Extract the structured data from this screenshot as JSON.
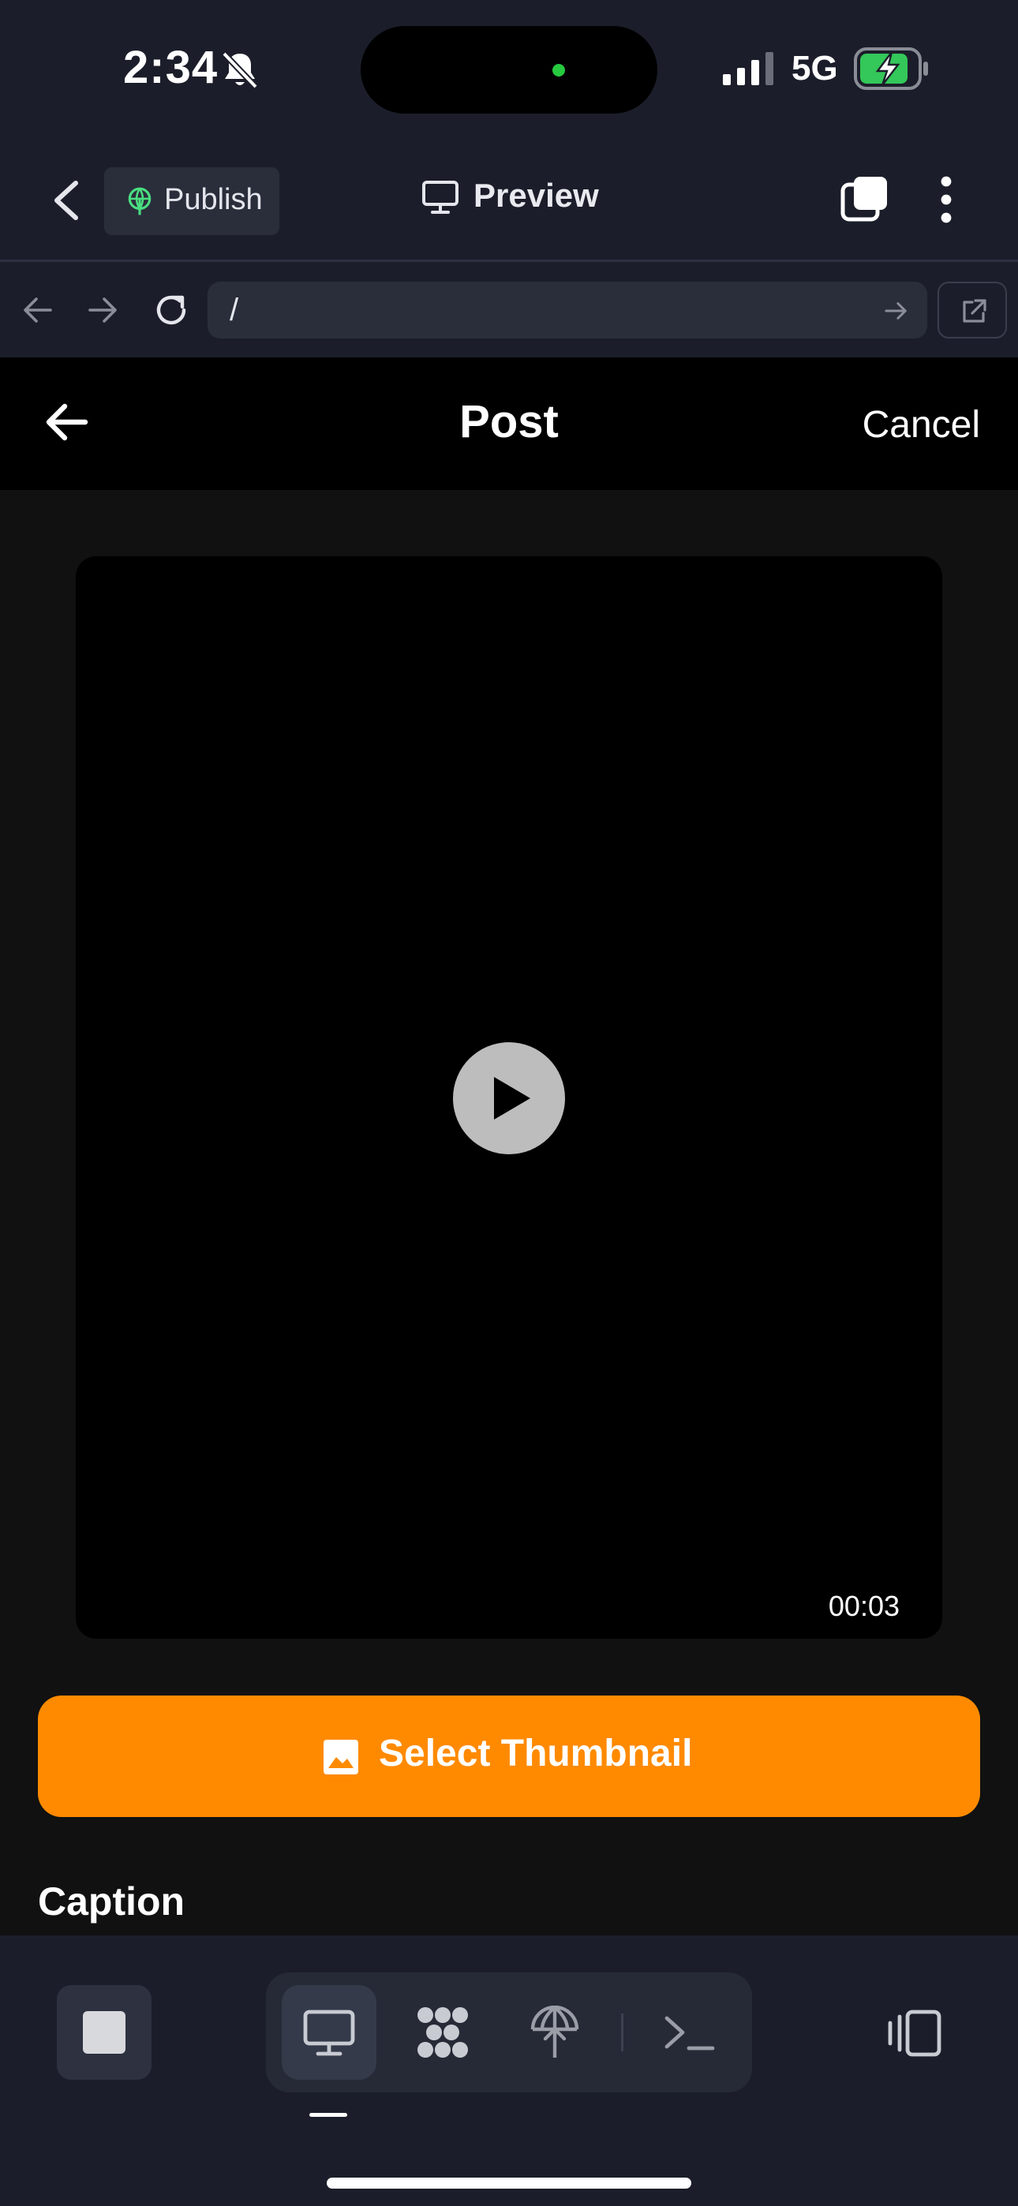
{
  "status_bar": {
    "time": "2:34",
    "network": "5G",
    "icons": [
      "bell-slash-icon",
      "signal-icon",
      "battery-charging-icon"
    ]
  },
  "toolbar": {
    "publish_label": "Publish",
    "preview_label": "Preview",
    "icons": [
      "chevron-left-icon",
      "globe-icon",
      "monitor-icon",
      "windows-icon",
      "more-vertical-icon"
    ]
  },
  "address_bar": {
    "url": "/",
    "icons": [
      "arrow-left-icon",
      "arrow-right-icon",
      "reload-icon",
      "go-arrow-icon",
      "external-link-icon"
    ]
  },
  "post_screen": {
    "title": "Post",
    "cancel_label": "Cancel",
    "video_duration": "00:03",
    "select_thumbnail_label": "Select Thumbnail",
    "caption_label": "Caption"
  },
  "dock": {
    "icons": [
      "stop-icon",
      "monitor-icon",
      "grid-icon",
      "publish-globe-icon",
      "terminal-icon",
      "layout-toggle-icon"
    ],
    "active_mode": "monitor"
  },
  "colors": {
    "accent_orange": "#ff8a00",
    "chrome_bg": "#1b1e2a",
    "page_bg": "#111111",
    "publish_green": "#4ade80"
  }
}
